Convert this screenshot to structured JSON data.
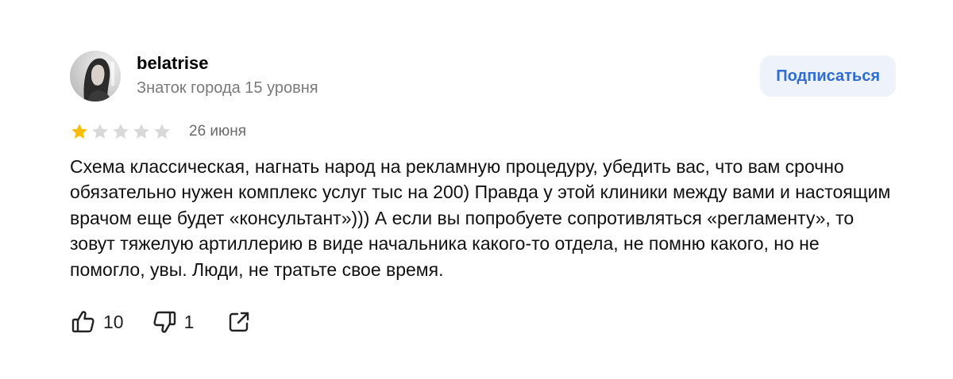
{
  "author": {
    "name": "belatrise",
    "status": "Знаток города 15 уровня"
  },
  "subscribe_label": "Подписаться",
  "rating": {
    "value": 1,
    "max": 5
  },
  "date": "26 июня",
  "text": "Схема классическая, нагнать народ на рекламную процедуру, убедить вас, что вам срочно обязательно нужен комплекс услуг тыс на 200) Правда у этой клиники между вами и настоящим врачом еще будет «консультант»))) А если вы попробуете сопротивляться «регламенту», то зовут тяжелую артиллерию в виде начальника какого-то отдела, не помню какого, но не помогло, увы. Люди, не тратьте свое время.",
  "reactions": {
    "likes": "10",
    "dislikes": "1"
  },
  "icons": {
    "like": "thumbs-up-icon",
    "dislike": "thumbs-down-icon",
    "share": "share-icon"
  },
  "colors": {
    "star_filled": "#fbbc04",
    "star_empty": "#d9d9d9",
    "accent": "#2f6cd6",
    "button_bg": "#eef3fb",
    "muted_text": "#7a7a7a"
  }
}
